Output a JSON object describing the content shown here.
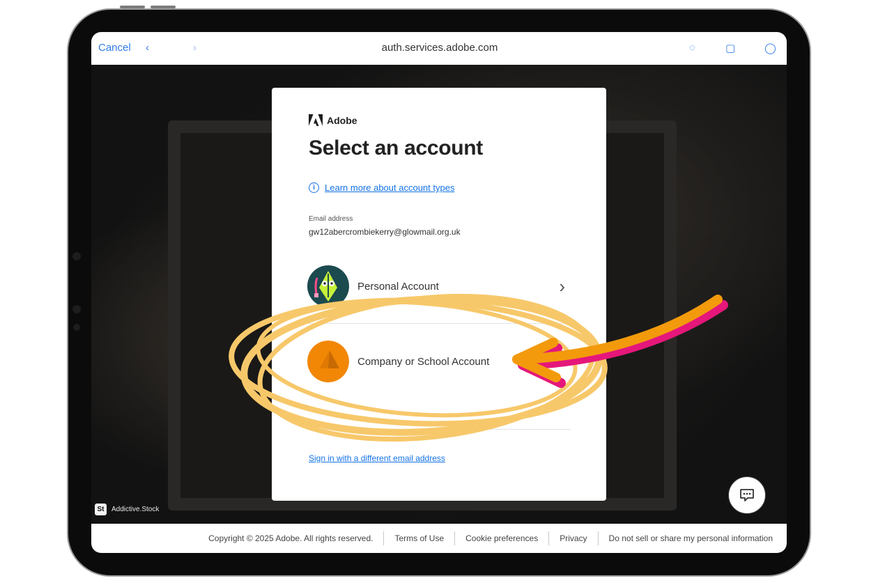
{
  "browser": {
    "cancel_label": "Cancel",
    "url": "auth.services.adobe.com"
  },
  "card": {
    "logo_text": "Adobe",
    "title": "Select an account",
    "learn_more_link": "Learn more about account types",
    "email_label": "Email address",
    "email_value": "gw12abercrombiekerry@glowmail.org.uk",
    "accounts": [
      {
        "label": "Personal Account"
      },
      {
        "label": "Company or School Account"
      }
    ],
    "different_email_link": "Sign in with a different email address"
  },
  "background": {
    "brand_icon_text": "St",
    "brand_text": "Addictive.Stock"
  },
  "footer": {
    "copyright": "Copyright © 2025 Adobe. All rights reserved.",
    "links": [
      "Terms of Use",
      "Cookie preferences",
      "Privacy",
      "Do not sell or share my personal information"
    ]
  },
  "colors": {
    "link_blue": "#1473e6",
    "highlight_yellow": "#f7c86a",
    "arrow_orange": "#f29a0c",
    "arrow_magenta": "#e5177a",
    "avatar_orange": "#f28705"
  },
  "icons": {
    "info": "info-icon",
    "chevron": "chevron-right-icon",
    "chat": "chat-icon"
  }
}
